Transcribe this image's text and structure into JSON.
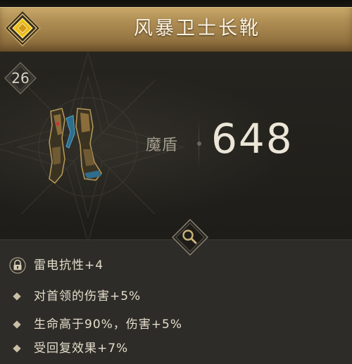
{
  "item": {
    "name": "风暴卫士长靴",
    "level": "26",
    "stat_label": "魔盾",
    "stat_value": "648"
  },
  "icons": {
    "rarity": "rarity-diamond-icon",
    "inspect": "magnifier-icon",
    "affix_lock": "padlock-icon",
    "affix_bullet": "diamond-bullet-icon"
  },
  "affixes": [
    {
      "text": "雷电抗性+4",
      "icon": "padlock-icon"
    },
    {
      "text": "对首领的伤害+5%",
      "icon": "diamond-bullet-icon"
    },
    {
      "text": "生命高于90%，伤害+5%",
      "icon": "diamond-bullet-icon"
    },
    {
      "text": "受回复效果+7%",
      "icon": "diamond-bullet-icon"
    }
  ],
  "colors": {
    "header_gold": "#b08f55",
    "rarity_yellow": "#f2c31c",
    "panel_dark": "#201f1b",
    "affix_panel": "#2e2c28",
    "stat_value": "#ece6d8"
  }
}
